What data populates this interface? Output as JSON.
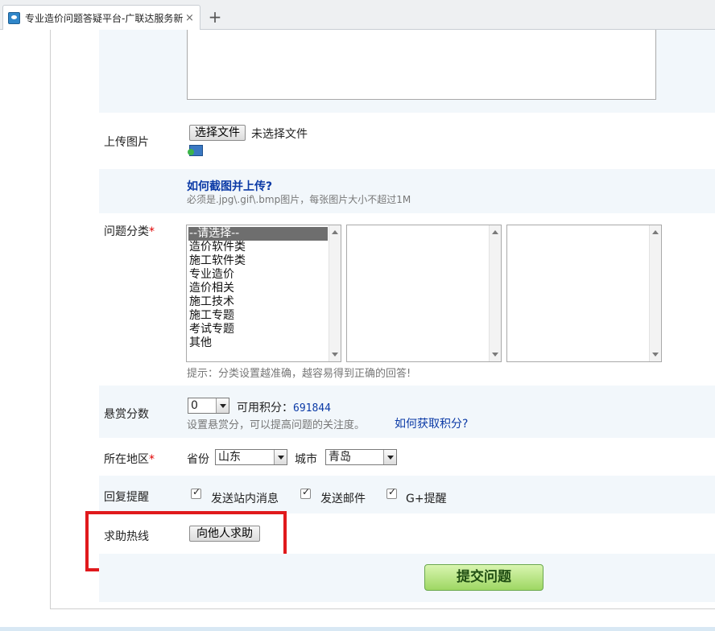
{
  "browser": {
    "tab_title": "专业造价问题答疑平台-广联达服务新",
    "tab_close": "×",
    "new_tab": "+"
  },
  "upload": {
    "label": "上传图片",
    "button": "选择文件",
    "status": "未选择文件",
    "howto_link": "如何截图并上传?",
    "note": "必须是.jpg\\.gif\\.bmp图片，每张图片大小不超过1M"
  },
  "category": {
    "label": "问题分类",
    "required_mark": "*",
    "options": [
      "--请选择--",
      "造价软件类",
      "施工软件类",
      "专业造价",
      "造价相关",
      "施工技术",
      "施工专题",
      "考试专题",
      "其他"
    ],
    "selected_index": 0,
    "hint": "提示：分类设置越准确，越容易得到正确的回答!"
  },
  "reward": {
    "label": "悬赏分数",
    "value": "0",
    "available_label": "可用积分：",
    "available_points": "691844",
    "hint": "设置悬赏分，可以提高问题的关注度。",
    "how_link": "如何获取积分?"
  },
  "region": {
    "label": "所在地区",
    "required_mark": "*",
    "province_label": "省份",
    "province": "山东",
    "city_label": "城市",
    "city": "青岛"
  },
  "notify": {
    "label": "回复提醒",
    "options": [
      {
        "label": "发送站内消息",
        "checked": true
      },
      {
        "label": "发送邮件",
        "checked": true
      },
      {
        "label": "G+提醒",
        "checked": true
      }
    ]
  },
  "hotline": {
    "label": "求助热线",
    "button": "向他人求助"
  },
  "submit": {
    "label": "提交问题"
  },
  "colors": {
    "row_background": "#f2f7fb",
    "link": "#0b3aa6",
    "required": "#e00000",
    "highlight_box": "#e0191c",
    "submit_green": "#9ed763"
  }
}
